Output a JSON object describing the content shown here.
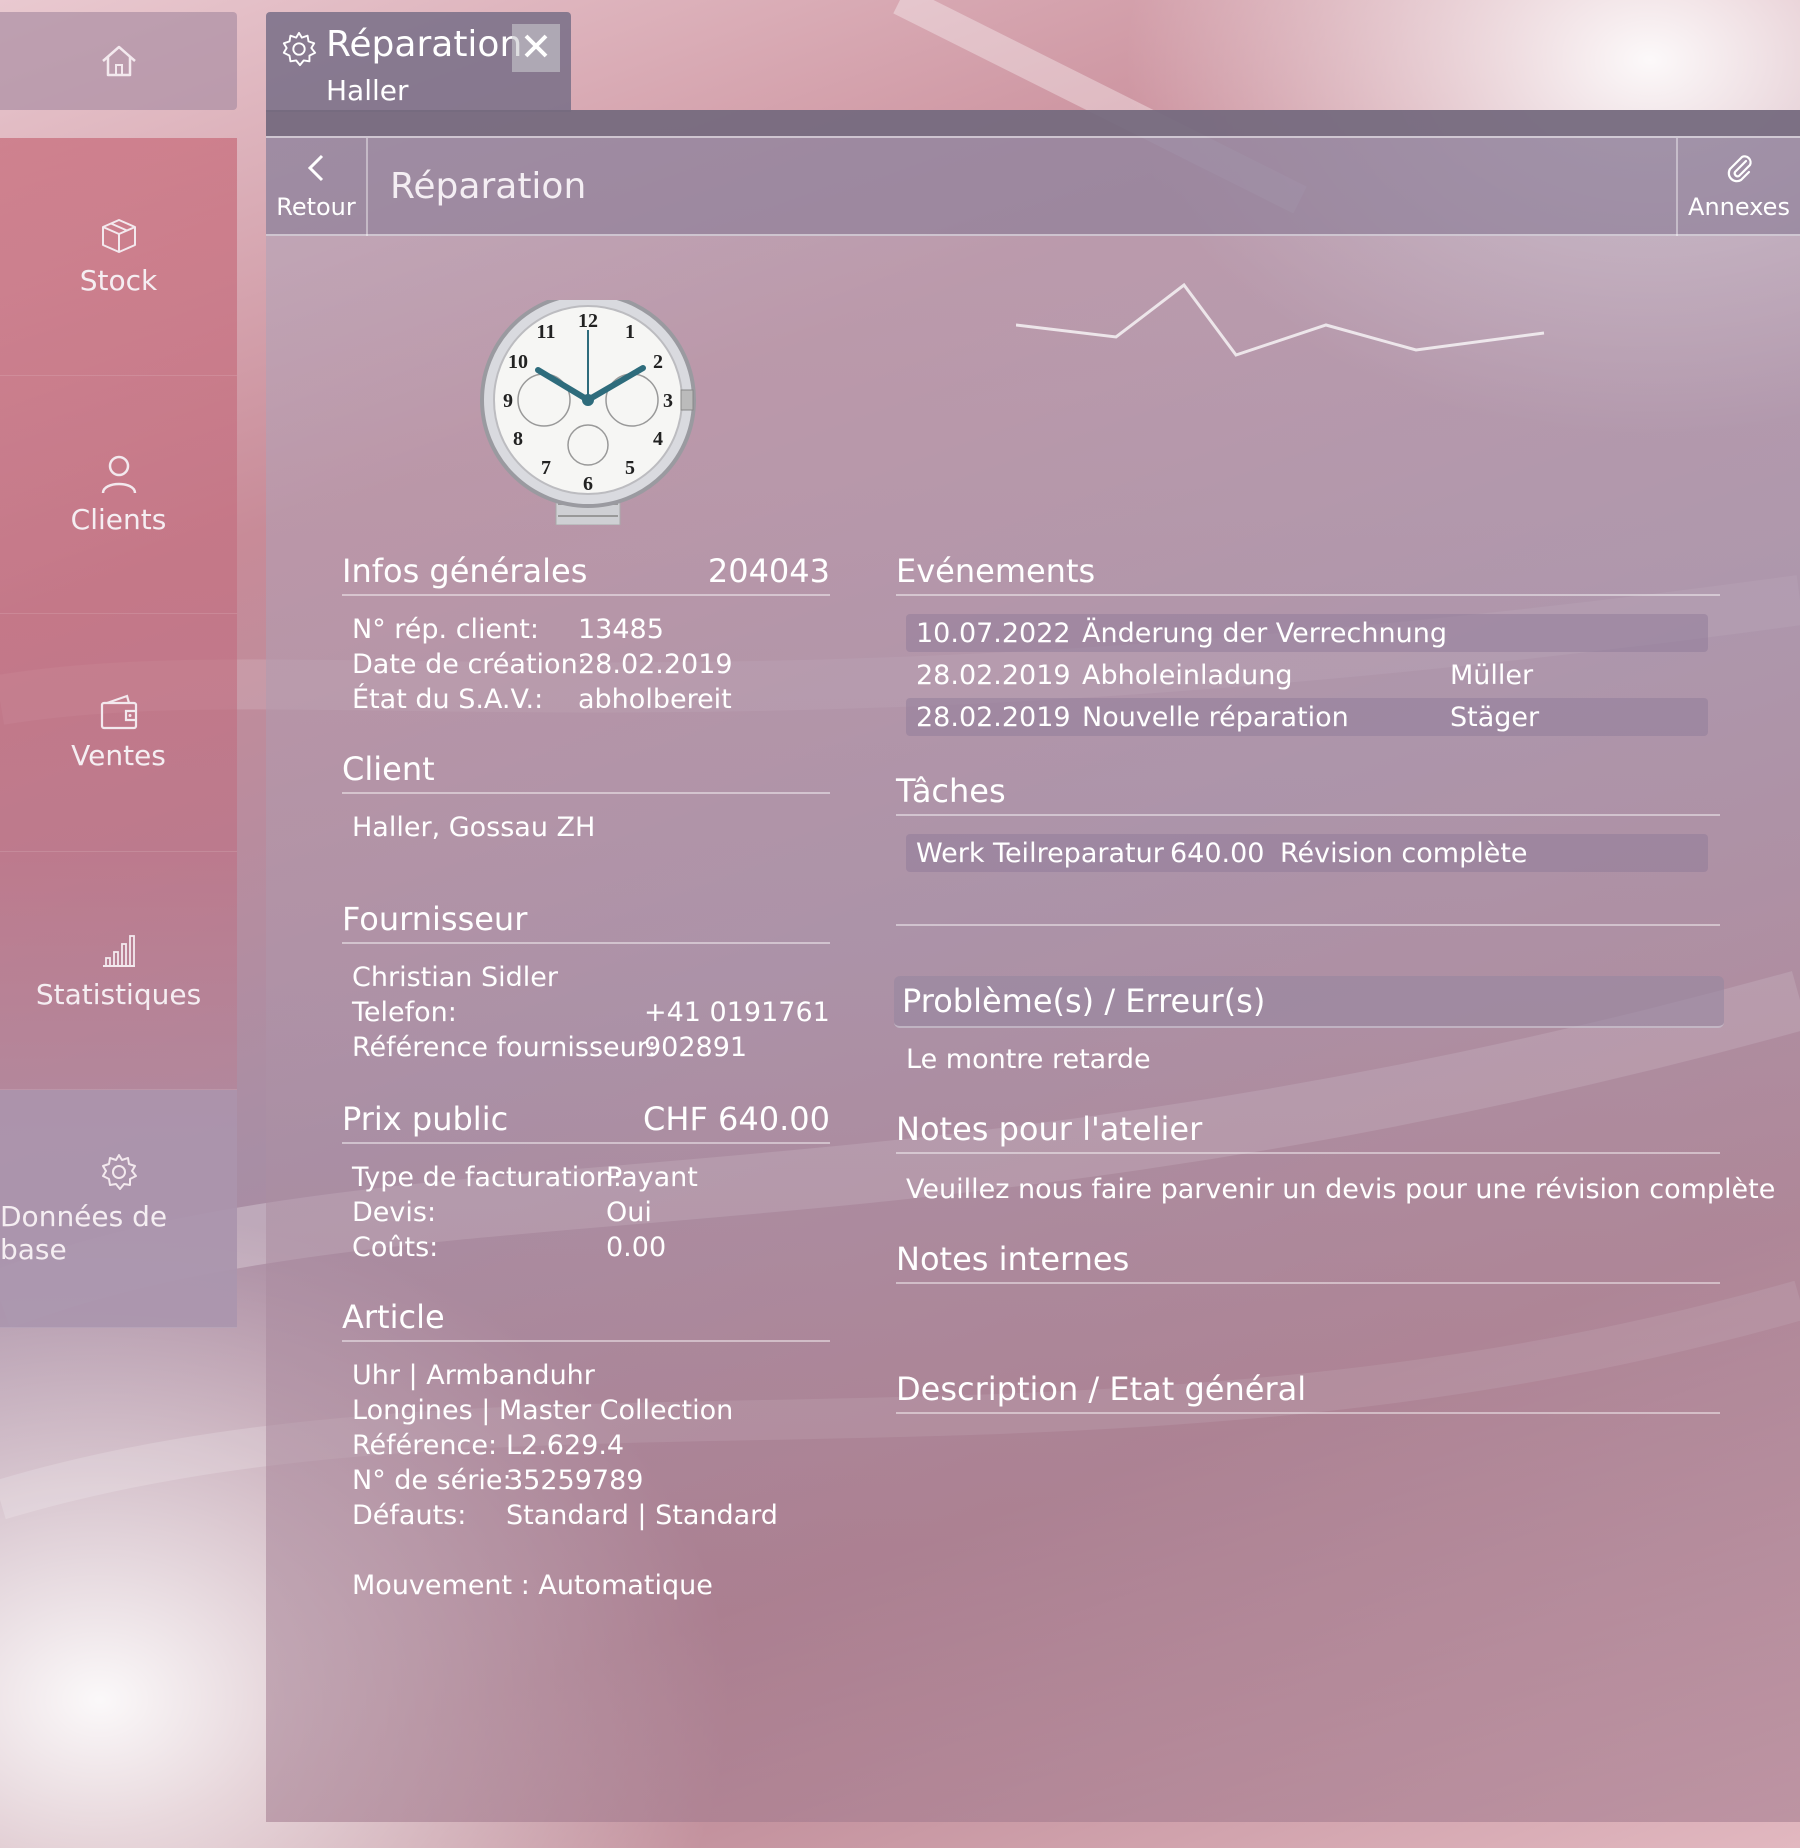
{
  "sidebar": {
    "items": [
      {
        "label": "Stock"
      },
      {
        "label": "Clients"
      },
      {
        "label": "Ventes"
      },
      {
        "label": "Statistiques"
      },
      {
        "label": "Données de base"
      }
    ]
  },
  "tab": {
    "title": "Réparation",
    "subtitle": "Haller"
  },
  "toolbar": {
    "back_label": "Retour",
    "title": "Réparation",
    "attachments_label": "Annexes"
  },
  "general": {
    "heading": "Infos générales",
    "number": "204043",
    "rows": [
      {
        "key": "N° rép. client:",
        "value": "13485"
      },
      {
        "key": "Date de création:",
        "value": "28.02.2019"
      },
      {
        "key": "État du S.A.V.:",
        "value": "abholbereit"
      }
    ]
  },
  "client": {
    "heading": "Client",
    "value": "Haller, Gossau ZH"
  },
  "supplier": {
    "heading": "Fournisseur",
    "name": "Christian Sidler",
    "phone_key": "Telefon:",
    "phone": "+41 0191761",
    "ref_key": "Référence fournisseur:",
    "ref": "902891"
  },
  "price": {
    "heading": "Prix public",
    "value": "CHF 640.00",
    "rows": [
      {
        "key": "Type de facturation:",
        "value": "Payant"
      },
      {
        "key": "Devis:",
        "value": "Oui"
      },
      {
        "key": "Coûts:",
        "value": "0.00"
      }
    ]
  },
  "article": {
    "heading": "Article",
    "line1": "Uhr | Armbanduhr",
    "line2": "Longines | Master Collection",
    "rows": [
      {
        "key": "Référence:",
        "value": "L2.629.4"
      },
      {
        "key": "N° de série:",
        "value": "35259789"
      },
      {
        "key": "Défauts:",
        "value": "Standard | Standard"
      }
    ],
    "movement": "Mouvement : Automatique"
  },
  "events": {
    "heading": "Evénements",
    "rows": [
      {
        "date": "10.07.2022",
        "text": "Änderung der Verrechnung",
        "user": ""
      },
      {
        "date": "28.02.2019",
        "text": "Abholeinladung",
        "user": "Müller"
      },
      {
        "date": "28.02.2019",
        "text": "Nouvelle réparation",
        "user": "Stäger"
      }
    ]
  },
  "tasks": {
    "heading": "Tâches",
    "rows": [
      {
        "name": "Werk Teilreparatur",
        "amount": "640.00",
        "desc": "Révision complète"
      }
    ]
  },
  "problems": {
    "heading": "Problème(s) / Erreur(s)",
    "text": "Le montre retarde"
  },
  "workshop_notes": {
    "heading": "Notes pour l'atelier",
    "text": "Veuillez nous faire parvenir un devis pour une révision complète"
  },
  "internal_notes": {
    "heading": "Notes internes"
  },
  "description": {
    "heading": "Description / Etat général"
  },
  "colors": {
    "accent_sidebar": "#c8707f",
    "toolbar": "#8c7d96"
  }
}
